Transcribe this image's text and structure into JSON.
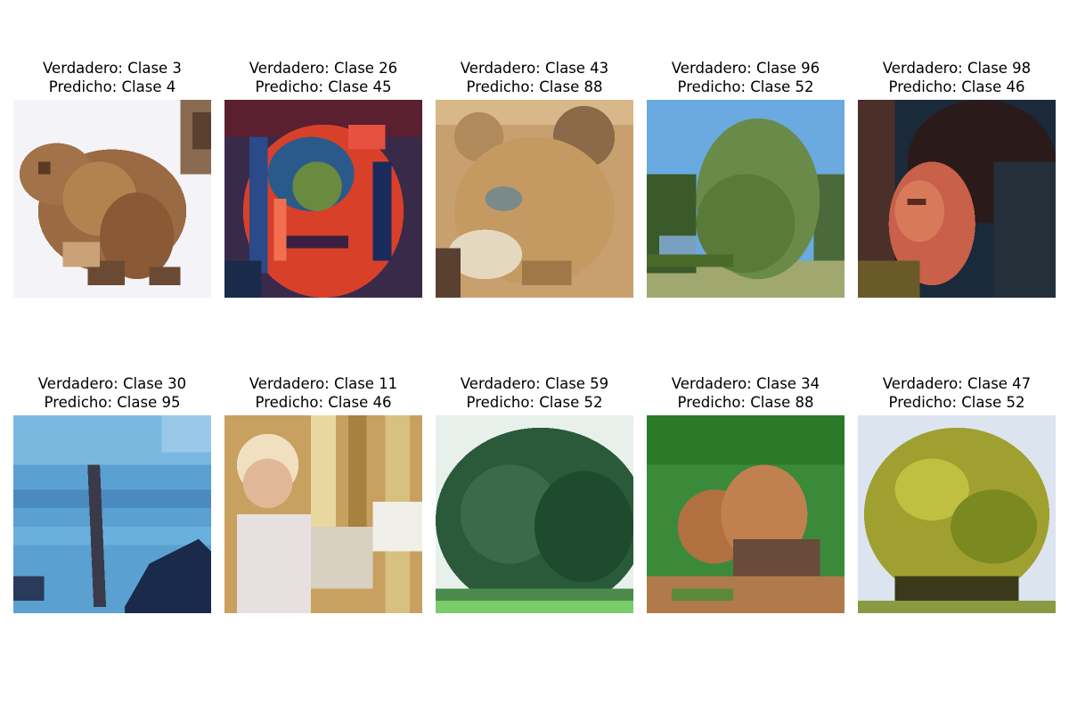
{
  "panels": [
    {
      "true_label": "Verdadero: Clase 3",
      "pred_label": "Predicho: Clase 4",
      "image": "bear-photo"
    },
    {
      "true_label": "Verdadero: Clase 26",
      "pred_label": "Predicho: Clase 45",
      "image": "red-fabric-photo"
    },
    {
      "true_label": "Verdadero: Clase 43",
      "pred_label": "Predicho: Clase 88",
      "image": "lion-cub-photo"
    },
    {
      "true_label": "Verdadero: Clase 96",
      "pred_label": "Predicho: Clase 52",
      "image": "willow-tree-photo"
    },
    {
      "true_label": "Verdadero: Clase 98",
      "pred_label": "Predicho: Clase 46",
      "image": "woman-face-photo"
    },
    {
      "true_label": "Verdadero: Clase 30",
      "pred_label": "Predicho: Clase 95",
      "image": "water-photo"
    },
    {
      "true_label": "Verdadero: Clase 11",
      "pred_label": "Predicho: Clase 46",
      "image": "child-photo"
    },
    {
      "true_label": "Verdadero: Clase 59",
      "pred_label": "Predicho: Clase 52",
      "image": "pine-tree-photo"
    },
    {
      "true_label": "Verdadero: Clase 34",
      "pred_label": "Predicho: Clase 88",
      "image": "foxes-photo"
    },
    {
      "true_label": "Verdadero: Clase 47",
      "pred_label": "Predicho: Clase 52",
      "image": "maple-tree-photo"
    }
  ]
}
